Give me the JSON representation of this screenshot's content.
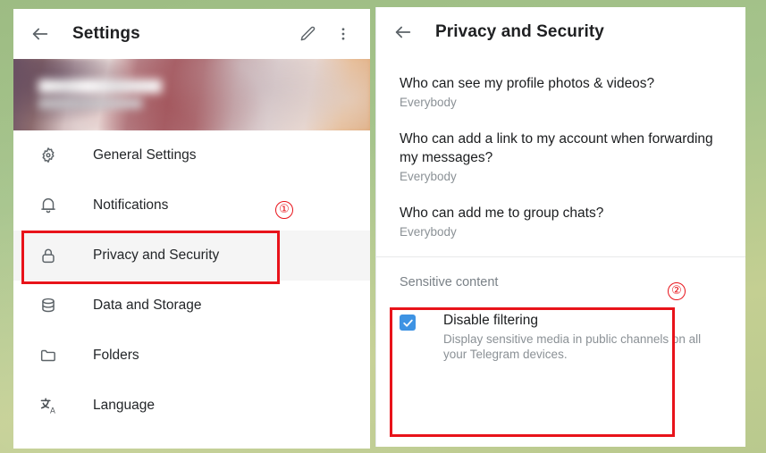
{
  "left_panel": {
    "appbar": {
      "back_icon": "arrow-left-icon",
      "title": "Settings",
      "edit_icon": "pencil-icon",
      "more_icon": "more-vertical-icon"
    },
    "banner": {
      "alt": "profile-cover-photo-blurred"
    },
    "items": [
      {
        "label": "General Settings",
        "icon": "gear-icon",
        "selected": false
      },
      {
        "label": "Notifications",
        "icon": "bell-icon",
        "selected": false
      },
      {
        "label": "Privacy and Security",
        "icon": "lock-icon",
        "selected": true
      },
      {
        "label": "Data and Storage",
        "icon": "database-icon",
        "selected": false
      },
      {
        "label": "Folders",
        "icon": "folder-icon",
        "selected": false
      },
      {
        "label": "Language",
        "icon": "translate-icon",
        "selected": false
      }
    ]
  },
  "right_panel": {
    "appbar": {
      "back_icon": "arrow-left-icon",
      "title": "Privacy and Security"
    },
    "privacy_rows": [
      {
        "question": "Who can see my profile photos & videos?",
        "value": "Everybody"
      },
      {
        "question": "Who can add a link to my account when forwarding my messages?",
        "value": "Everybody"
      },
      {
        "question": "Who can add me to group chats?",
        "value": "Everybody"
      }
    ],
    "sensitive_content": {
      "section_title": "Sensitive content",
      "checkbox_checked": true,
      "checkbox_icon": "check-icon",
      "label": "Disable filtering",
      "description": "Display sensitive media in public channels on all your Telegram devices."
    }
  },
  "annotations": {
    "marker_1": "①",
    "marker_2": "②",
    "color": "#e8131a"
  },
  "colors": {
    "accent_blue": "#3e93e3",
    "wallpaper_green": "#a6c48c",
    "selected_row": "#f5f5f5",
    "muted_text": "#8b9196"
  }
}
